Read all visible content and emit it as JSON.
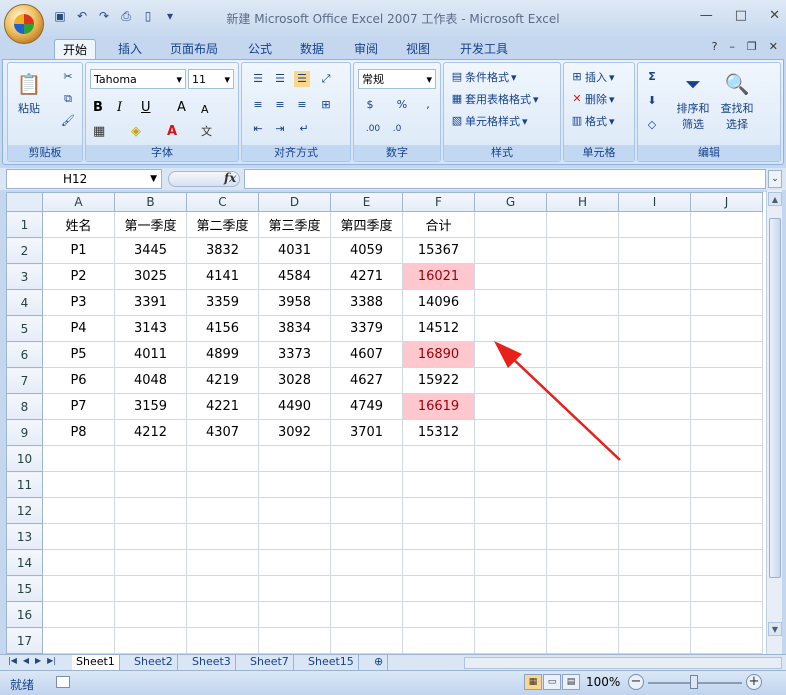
{
  "window": {
    "title": "新建 Microsoft Office Excel 2007 工作表 - Microsoft Excel",
    "controls": [
      "—",
      "□",
      "✕"
    ]
  },
  "ribbon_tabs": [
    "开始",
    "插入",
    "页面布局",
    "公式",
    "数据",
    "审阅",
    "视图",
    "开发工具"
  ],
  "ribbon": {
    "clipboard": {
      "paste": "粘贴",
      "label": "剪贴板"
    },
    "font": {
      "name": "Tahoma",
      "size": "11",
      "label": "字体"
    },
    "alignment": {
      "label": "对齐方式"
    },
    "number": {
      "format": "常规",
      "label": "数字"
    },
    "styles": {
      "conditional": "条件格式",
      "table": "套用表格格式",
      "cell": "单元格样式",
      "label": "样式"
    },
    "cells": {
      "insert": "插入",
      "delete": "删除",
      "format": "格式",
      "label": "单元格"
    },
    "editing": {
      "sort": "排序和",
      "sort2": "筛选",
      "find": "查找和",
      "find2": "选择",
      "label": "编辑"
    }
  },
  "formula_bar": {
    "name_box": "H12",
    "fx": "fx",
    "formula": ""
  },
  "columns": [
    "A",
    "B",
    "C",
    "D",
    "E",
    "F",
    "G",
    "H",
    "I",
    "J"
  ],
  "rows": [
    [
      "姓名",
      "第一季度",
      "第二季度",
      "第三季度",
      "第四季度",
      "合计"
    ],
    [
      "P1",
      "3445",
      "3832",
      "4031",
      "4059",
      "15367"
    ],
    [
      "P2",
      "3025",
      "4141",
      "4584",
      "4271",
      "16021"
    ],
    [
      "P3",
      "3391",
      "3359",
      "3958",
      "3388",
      "14096"
    ],
    [
      "P4",
      "3143",
      "4156",
      "3834",
      "3379",
      "14512"
    ],
    [
      "P5",
      "4011",
      "4899",
      "3373",
      "4607",
      "16890"
    ],
    [
      "P6",
      "4048",
      "4219",
      "3028",
      "4627",
      "15922"
    ],
    [
      "P7",
      "3159",
      "4221",
      "4490",
      "4749",
      "16619"
    ],
    [
      "P8",
      "4212",
      "4307",
      "3092",
      "3701",
      "15312"
    ]
  ],
  "row_numbers": [
    "1",
    "2",
    "3",
    "4",
    "5",
    "6",
    "7",
    "8",
    "9",
    "10",
    "11",
    "12",
    "13",
    "14",
    "15",
    "16",
    "17"
  ],
  "highlighted_rows": [
    2,
    5,
    7
  ],
  "highlight_color": "#ffc7ce",
  "sheets": [
    "Sheet1",
    "Sheet2",
    "Sheet3",
    "Sheet7",
    "Sheet15"
  ],
  "active_sheet": "Sheet1",
  "status": {
    "text": "就绪",
    "zoom": "100%"
  },
  "annotation_color": "#e8201a"
}
